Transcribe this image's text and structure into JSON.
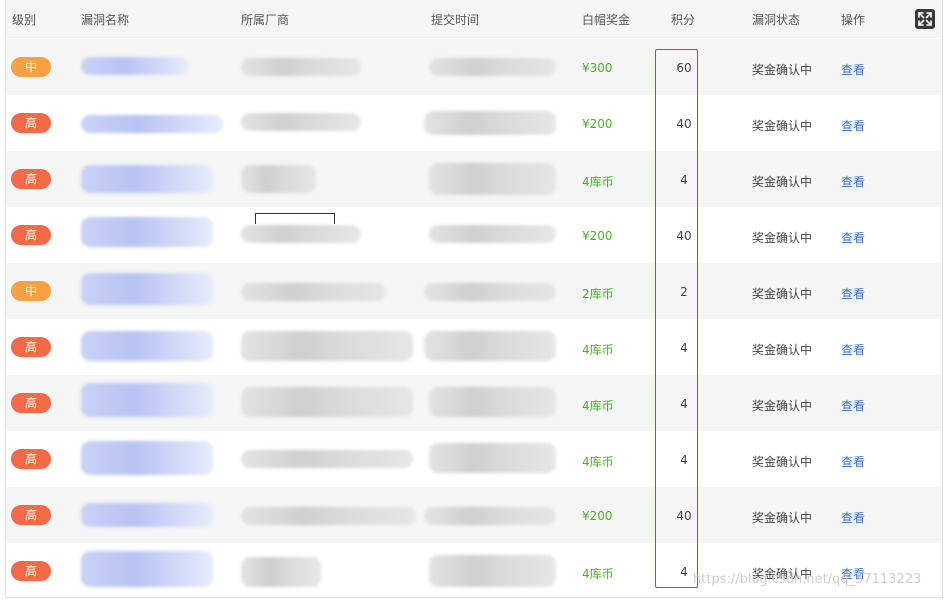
{
  "header": {
    "level": "级别",
    "vuln_name": "漏洞名称",
    "vendor": "所属厂商",
    "submit_time": "提交时间",
    "reward": "白帽奖金",
    "points": "积分",
    "vuln_status": "漏洞状态",
    "action": "操作",
    "expand_icon": "fullscreen-icon"
  },
  "rows": [
    {
      "level": "中",
      "reward": "¥300",
      "points": "60",
      "status": "奖金确认中",
      "action": "查看"
    },
    {
      "level": "高",
      "reward": "¥200",
      "points": "40",
      "status": "奖金确认中",
      "action": "查看"
    },
    {
      "level": "高",
      "reward": "4库币",
      "points": "4",
      "status": "奖金确认中",
      "action": "查看"
    },
    {
      "level": "高",
      "reward": "¥200",
      "points": "40",
      "status": "奖金确认中",
      "action": "查看"
    },
    {
      "level": "中",
      "reward": "2库币",
      "points": "2",
      "status": "奖金确认中",
      "action": "查看"
    },
    {
      "level": "高",
      "reward": "4库币",
      "points": "4",
      "status": "奖金确认中",
      "action": "查看"
    },
    {
      "level": "高",
      "reward": "4库币",
      "points": "4",
      "status": "奖金确认中",
      "action": "查看"
    },
    {
      "level": "高",
      "reward": "4库币",
      "points": "4",
      "status": "奖金确认中",
      "action": "查看"
    },
    {
      "level": "高",
      "reward": "¥200",
      "points": "40",
      "status": "奖金确认中",
      "action": "查看"
    },
    {
      "level": "高",
      "reward": "4库币",
      "points": "4",
      "status": "奖金确认中",
      "action": "查看"
    }
  ],
  "colors": {
    "high_badge": "#f46a48",
    "mid_badge": "#f7a044",
    "reward_green": "#4fae2f",
    "link_blue": "#3a6fd8",
    "highlight_red": "#dd3333"
  },
  "watermark": "https://blog.csdn.net/qq_37113223"
}
